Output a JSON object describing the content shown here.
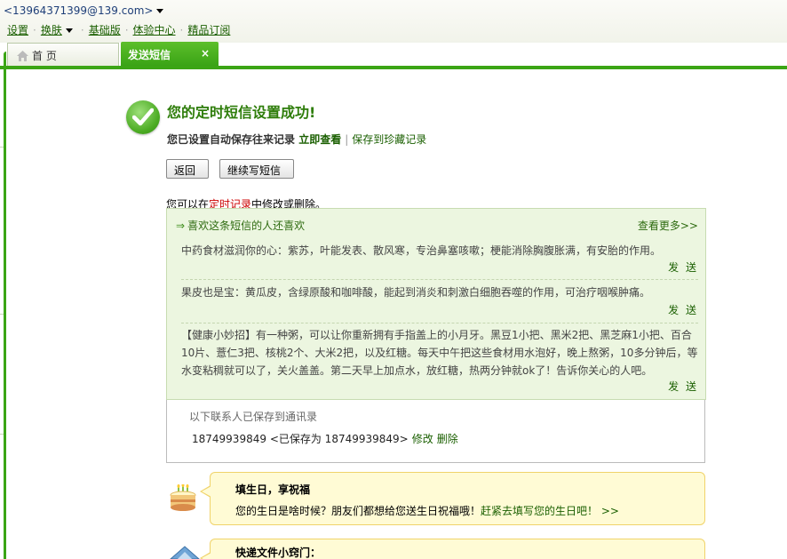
{
  "header": {
    "account": "<13964371399@139.com>",
    "nav": {
      "settings": "设置",
      "skin": "换肤",
      "basic": "基础版",
      "experience": "体验中心",
      "subscribe": "精品订阅"
    }
  },
  "tabs": {
    "home": "首 页",
    "sms": "发送短信",
    "close": "×"
  },
  "success": {
    "title": "您的定时短信设置成功!",
    "sub_text": "您已设置自动保存往来记录",
    "view_now": "立即查看",
    "separator": "|",
    "save_fav": "保存到珍藏记录"
  },
  "buttons": {
    "back": "返回",
    "continue": "继续写短信"
  },
  "hint": {
    "prefix": "您可以在",
    "link": "定时记录",
    "suffix": "中修改或删除。"
  },
  "recommend": {
    "heading": "喜欢这条短信的人还喜欢",
    "more": "查看更多>>",
    "send_label": "发 送",
    "items": [
      "中药食材滋润你的心：紫苏，叶能发表、散风寒，专治鼻塞咳嗽；梗能消除胸腹胀满，有安胎的作用。",
      "果皮也是宝：黄瓜皮，含绿原酸和咖啡酸，能起到消炎和刺激白细胞吞噬的作用，可治疗咽喉肿痛。",
      "【健康小妙招】有一种粥，可以让你重新拥有手指盖上的小月牙。黑豆1小把、黑米2把、黑芝麻1小把、百合10片、薏仁3把、核桃2个、大米2把，以及红糖。每天中午把这些食材用水泡好，晚上熬粥，10多分钟后，等水变粘稠就可以了，关火盖盖。第二天早上加点水，放红糖，热两分钟就ok了！告诉你关心的人吧。"
    ]
  },
  "saved": {
    "title": "以下联系人已保存到通讯录",
    "number": "18749939849",
    "saved_as": "<已保存为 18749939849>",
    "edit": "修改",
    "delete": "删除"
  },
  "tips": [
    {
      "title": "填生日，享祝福",
      "body": "您的生日是啥时候？朋友们都想给您送生日祝福哦！",
      "link": "赶紧去填写您的生日吧！ >>"
    },
    {
      "title": "快递文件小窍门："
    }
  ]
}
